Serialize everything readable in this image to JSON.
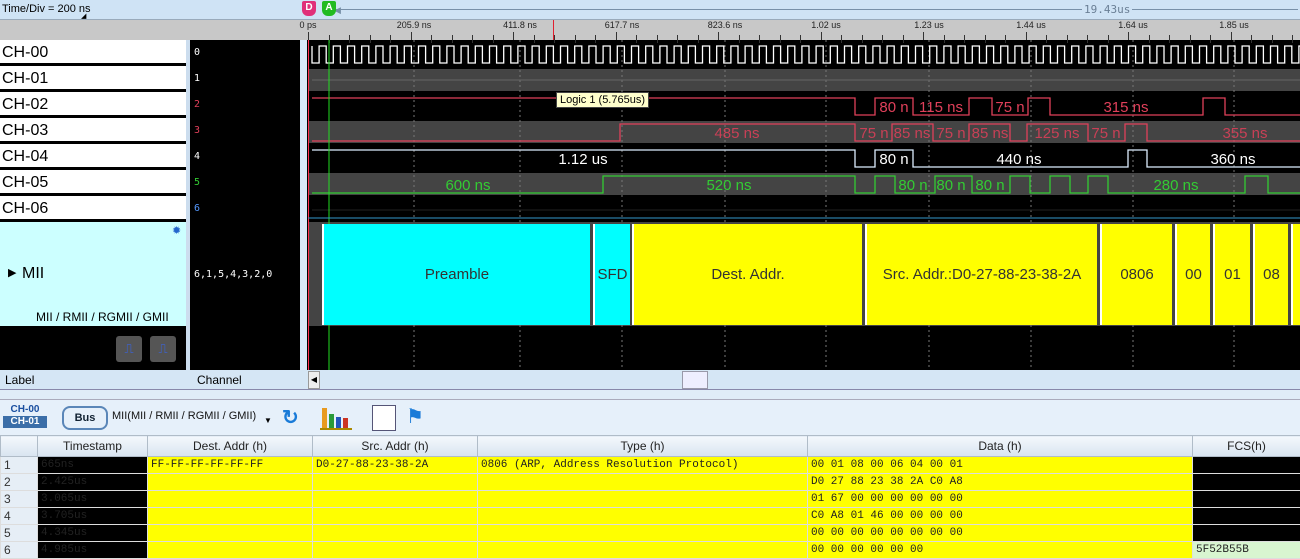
{
  "header": {
    "time_div": "Time/Div = 200 ns",
    "span": "19.43us",
    "cursor_d": "D",
    "cursor_a": "A"
  },
  "ruler": {
    "ticks": [
      "0 ps",
      "205.9 ns",
      "411.8 ns",
      "617.7 ns",
      "823.6 ns",
      "1.02 us",
      "1.23 us",
      "1.44 us",
      "1.64 us",
      "1.85 us"
    ]
  },
  "channels": [
    {
      "label": "CH-00",
      "num": "0",
      "color": "#ffffff",
      "labels": []
    },
    {
      "label": "CH-01",
      "num": "1",
      "color": "#ffffff",
      "labels": []
    },
    {
      "label": "CH-02",
      "num": "2",
      "color": "#e0405a",
      "labels": [
        "80 n",
        "115 ns",
        "75 n",
        "315 ns"
      ]
    },
    {
      "label": "CH-03",
      "num": "3",
      "color": "#e0405a",
      "labels": [
        "485 ns",
        "75 n",
        "85 ns",
        "75 n",
        "85 ns",
        "125 ns",
        "75 n",
        "355 ns"
      ]
    },
    {
      "label": "CH-04",
      "num": "4",
      "color": "#ffffff",
      "labels": [
        "1.12 us",
        "80 n",
        "440 ns",
        "360 ns"
      ]
    },
    {
      "label": "CH-05",
      "num": "5",
      "color": "#33cc33",
      "labels": [
        "600 ns",
        "520 ns",
        "80 n",
        "80 n",
        "80 n",
        "280 ns"
      ]
    },
    {
      "label": "CH-06",
      "num": "6",
      "color": "#5599ff",
      "labels": []
    }
  ],
  "bus": {
    "name": "MII",
    "subtitle": "MII / RMII / RGMII / GMII",
    "channels": "6,1,5,4,3,2,0",
    "segments": [
      {
        "text": "Preamble",
        "color": "#00ffff"
      },
      {
        "text": "SFD",
        "color": "#00ffff"
      },
      {
        "text": "Dest. Addr.",
        "color": "#ffff00"
      },
      {
        "text": "Src. Addr.:D0-27-88-23-38-2A",
        "color": "#ffff00"
      },
      {
        "text": "0806",
        "color": "#ffff00"
      },
      {
        "text": "00",
        "color": "#ffff00"
      },
      {
        "text": "01",
        "color": "#ffff00"
      },
      {
        "text": "08",
        "color": "#ffff00"
      },
      {
        "text": "",
        "color": "#ffff00"
      }
    ]
  },
  "tooltip": "Logic 1 (5.765us)",
  "columns_bar": {
    "label": "Label",
    "channel": "Channel"
  },
  "toolbar": {
    "ch_a": "CH-00",
    "ch_b": "CH-01",
    "bus": "Bus",
    "protocol": "MII(MII / RMII / RGMII / GMII)"
  },
  "table": {
    "headers": [
      "",
      "Timestamp",
      "Dest. Addr (h)",
      "Src. Addr (h)",
      "Type (h)",
      "Data (h)",
      "FCS(h)"
    ],
    "rows": [
      [
        "1",
        "665ns",
        "FF-FF-FF-FF-FF-FF",
        "D0-27-88-23-38-2A",
        "0806 (ARP, Address Resolution Protocol)",
        "00 01 08 00 06 04 00 01",
        ""
      ],
      [
        "2",
        "2.425us",
        "",
        "",
        "",
        "D0 27 88 23 38 2A C0 A8",
        ""
      ],
      [
        "3",
        "3.065us",
        "",
        "",
        "",
        "01 67 00 00 00 00 00 00",
        ""
      ],
      [
        "4",
        "3.705us",
        "",
        "",
        "",
        "C0 A8 01 46 00 00 00 00",
        ""
      ],
      [
        "5",
        "4.345us",
        "",
        "",
        "",
        "00 00 00 00 00 00 00 00",
        ""
      ],
      [
        "6",
        "4.985us",
        "",
        "",
        "",
        "00 00 00 00 00 00",
        "5F52B55B"
      ]
    ]
  }
}
